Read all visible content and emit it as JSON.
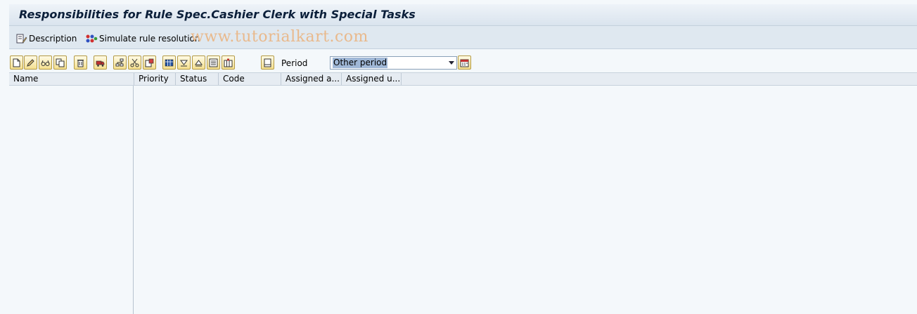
{
  "title": "Responsibilities for Rule Spec.Cashier Clerk with Special Tasks",
  "app_toolbar": {
    "description_label": "Description",
    "simulate_label": "Simulate rule resolution"
  },
  "watermark": "www.tutorialkart.com",
  "alv_toolbar": {
    "period_label": "Period",
    "period_value": "Other period"
  },
  "grid": {
    "columns": [
      "Name",
      "Priority",
      "Status",
      "Code",
      "Assigned a...",
      "Assigned u..."
    ]
  },
  "colors": {
    "title_text": "#0b1f3a",
    "toolbar_button": "#f4df8f",
    "selection": "#9fb7d6"
  }
}
